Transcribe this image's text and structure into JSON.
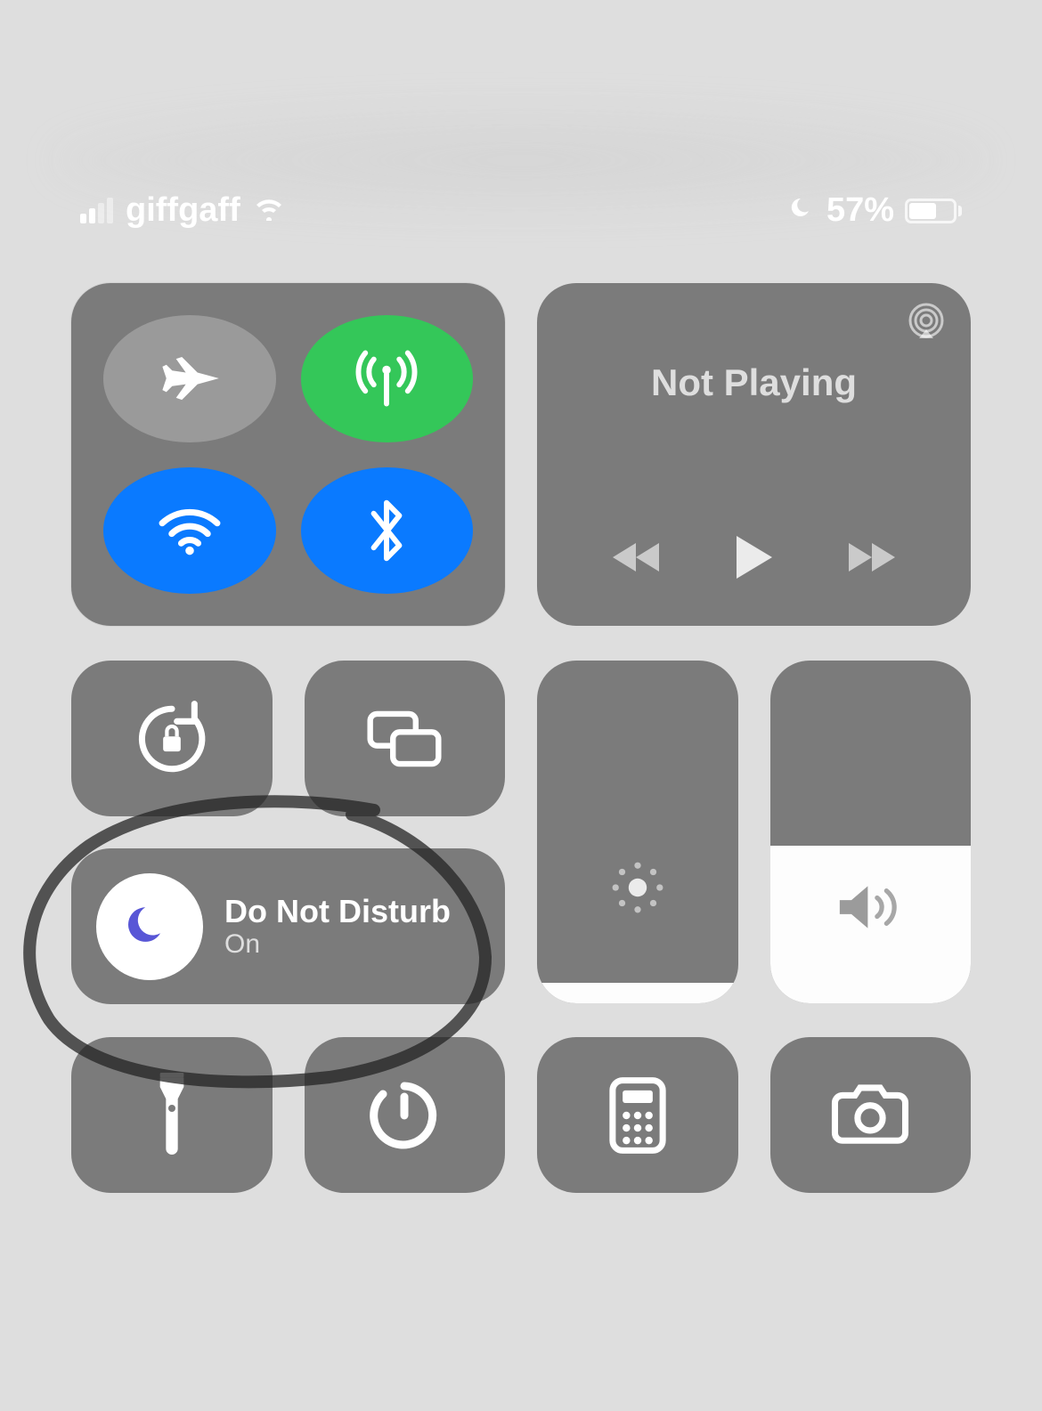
{
  "status": {
    "carrier": "giffgaff",
    "battery_percent": "57%",
    "dnd_active": true
  },
  "media": {
    "title": "Not Playing"
  },
  "dnd": {
    "title": "Do Not Disturb",
    "status": "On"
  },
  "toggles": {
    "airplane": false,
    "cellular": true,
    "wifi": true,
    "bluetooth": true
  },
  "sliders": {
    "brightness_fill_percent": 6,
    "volume_fill_percent": 46
  }
}
